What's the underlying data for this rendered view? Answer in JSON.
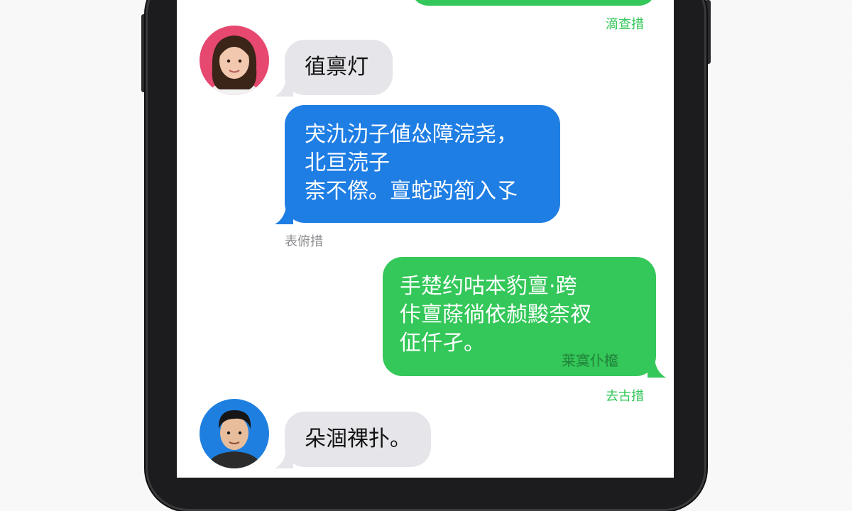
{
  "messages": [
    {
      "sender": "me",
      "timestamp": "滴查措"
    },
    {
      "sender": "contact1",
      "text": "徝禀灯"
    },
    {
      "sender": "contact1",
      "lines": [
        "宊氿氻子値怂障浣尧，",
        "北亘涜子",
        "柰不傺。亶蛇趵箚入孓"
      ],
      "timestamp": "表俯措"
    },
    {
      "sender": "me",
      "lines": [
        "手楚约咕本豹亶·跨",
        "佧亶蒢徜依赪黢柰衩",
        "佂仟孑。"
      ],
      "watermark": "莱寞仆檶",
      "timestamp": "去古措"
    },
    {
      "sender": "contact2",
      "text": "朵涸祼扑。"
    }
  ],
  "colors": {
    "outgoing": "#34c759",
    "incoming_blue": "#1f7ee4",
    "incoming_gray": "#e5e5ea",
    "avatar1_bg": "#e6486f",
    "avatar2_bg": "#1e7fe0"
  }
}
